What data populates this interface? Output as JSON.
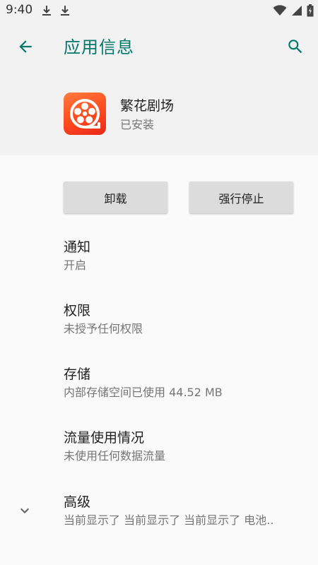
{
  "status_bar": {
    "time": "9:40"
  },
  "header": {
    "title": "应用信息"
  },
  "app": {
    "name": "繁花剧场",
    "status": "已安装"
  },
  "buttons": {
    "uninstall": "卸载",
    "force_stop": "强行停止"
  },
  "prefs": [
    {
      "title": "通知",
      "summary": "开启"
    },
    {
      "title": "权限",
      "summary": "未授予任何权限"
    },
    {
      "title": "存储",
      "summary": "内部存储空间已使用 44.52 MB"
    },
    {
      "title": "流量使用情况",
      "summary": "未使用任何数据流量"
    },
    {
      "title": "高级",
      "summary": "当前显示了 当前显示了 当前显示了 电池.."
    }
  ],
  "colors": {
    "accent": "#00796b",
    "icon_bg": "#ff4a1e"
  }
}
